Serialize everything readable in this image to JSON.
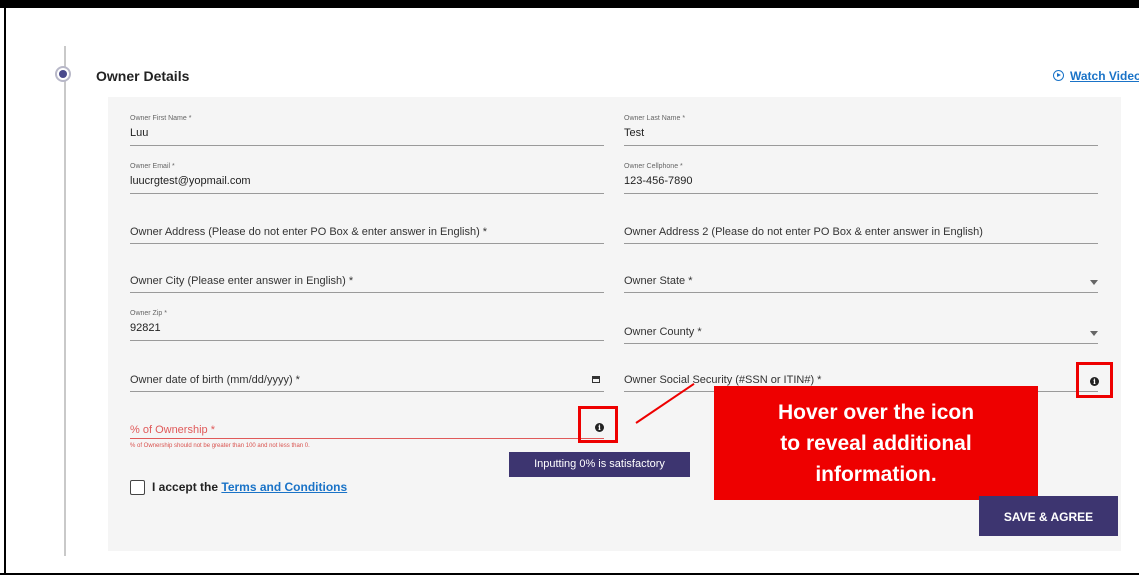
{
  "section": {
    "title": "Owner Details",
    "watch_video_label": "Watch Video"
  },
  "fields": {
    "first_name": {
      "label": "Owner First Name *",
      "value": "Luu"
    },
    "last_name": {
      "label": "Owner Last Name *",
      "value": "Test"
    },
    "email": {
      "label": "Owner Email *",
      "value": "luucrgtest@yopmail.com"
    },
    "cellphone": {
      "label": "Owner Cellphone *",
      "value": "123-456-7890"
    },
    "address": {
      "placeholder": "Owner Address (Please do not enter PO Box & enter answer in English) *"
    },
    "address2": {
      "placeholder": "Owner Address 2 (Please do not enter PO Box & enter answer in English)"
    },
    "city": {
      "placeholder": "Owner City (Please enter answer in English) *"
    },
    "state": {
      "placeholder": "Owner State *"
    },
    "zip": {
      "label": "Owner Zip *",
      "value": "92821"
    },
    "county": {
      "placeholder": "Owner County *"
    },
    "dob": {
      "placeholder": "Owner date of birth (mm/dd/yyyy) *"
    },
    "ssn": {
      "placeholder": "Owner Social Security (#SSN or ITIN#) *"
    },
    "ownership": {
      "placeholder": "% of Ownership *",
      "error": "% of Ownership should not be greater than 100 and not less than 0."
    }
  },
  "terms": {
    "prefix": "I accept the",
    "link": "Terms and Conditions"
  },
  "tooltip": "Inputting 0% is satisfactory",
  "callout": {
    "line1": "Hover over the icon",
    "line2": "to reveal additional",
    "line3": "information."
  },
  "save_button": "SAVE & AGREE",
  "colors": {
    "accent": "#3d3570",
    "link": "#1a73c7",
    "error": "#e05a5a",
    "annotation": "#ee0000"
  }
}
